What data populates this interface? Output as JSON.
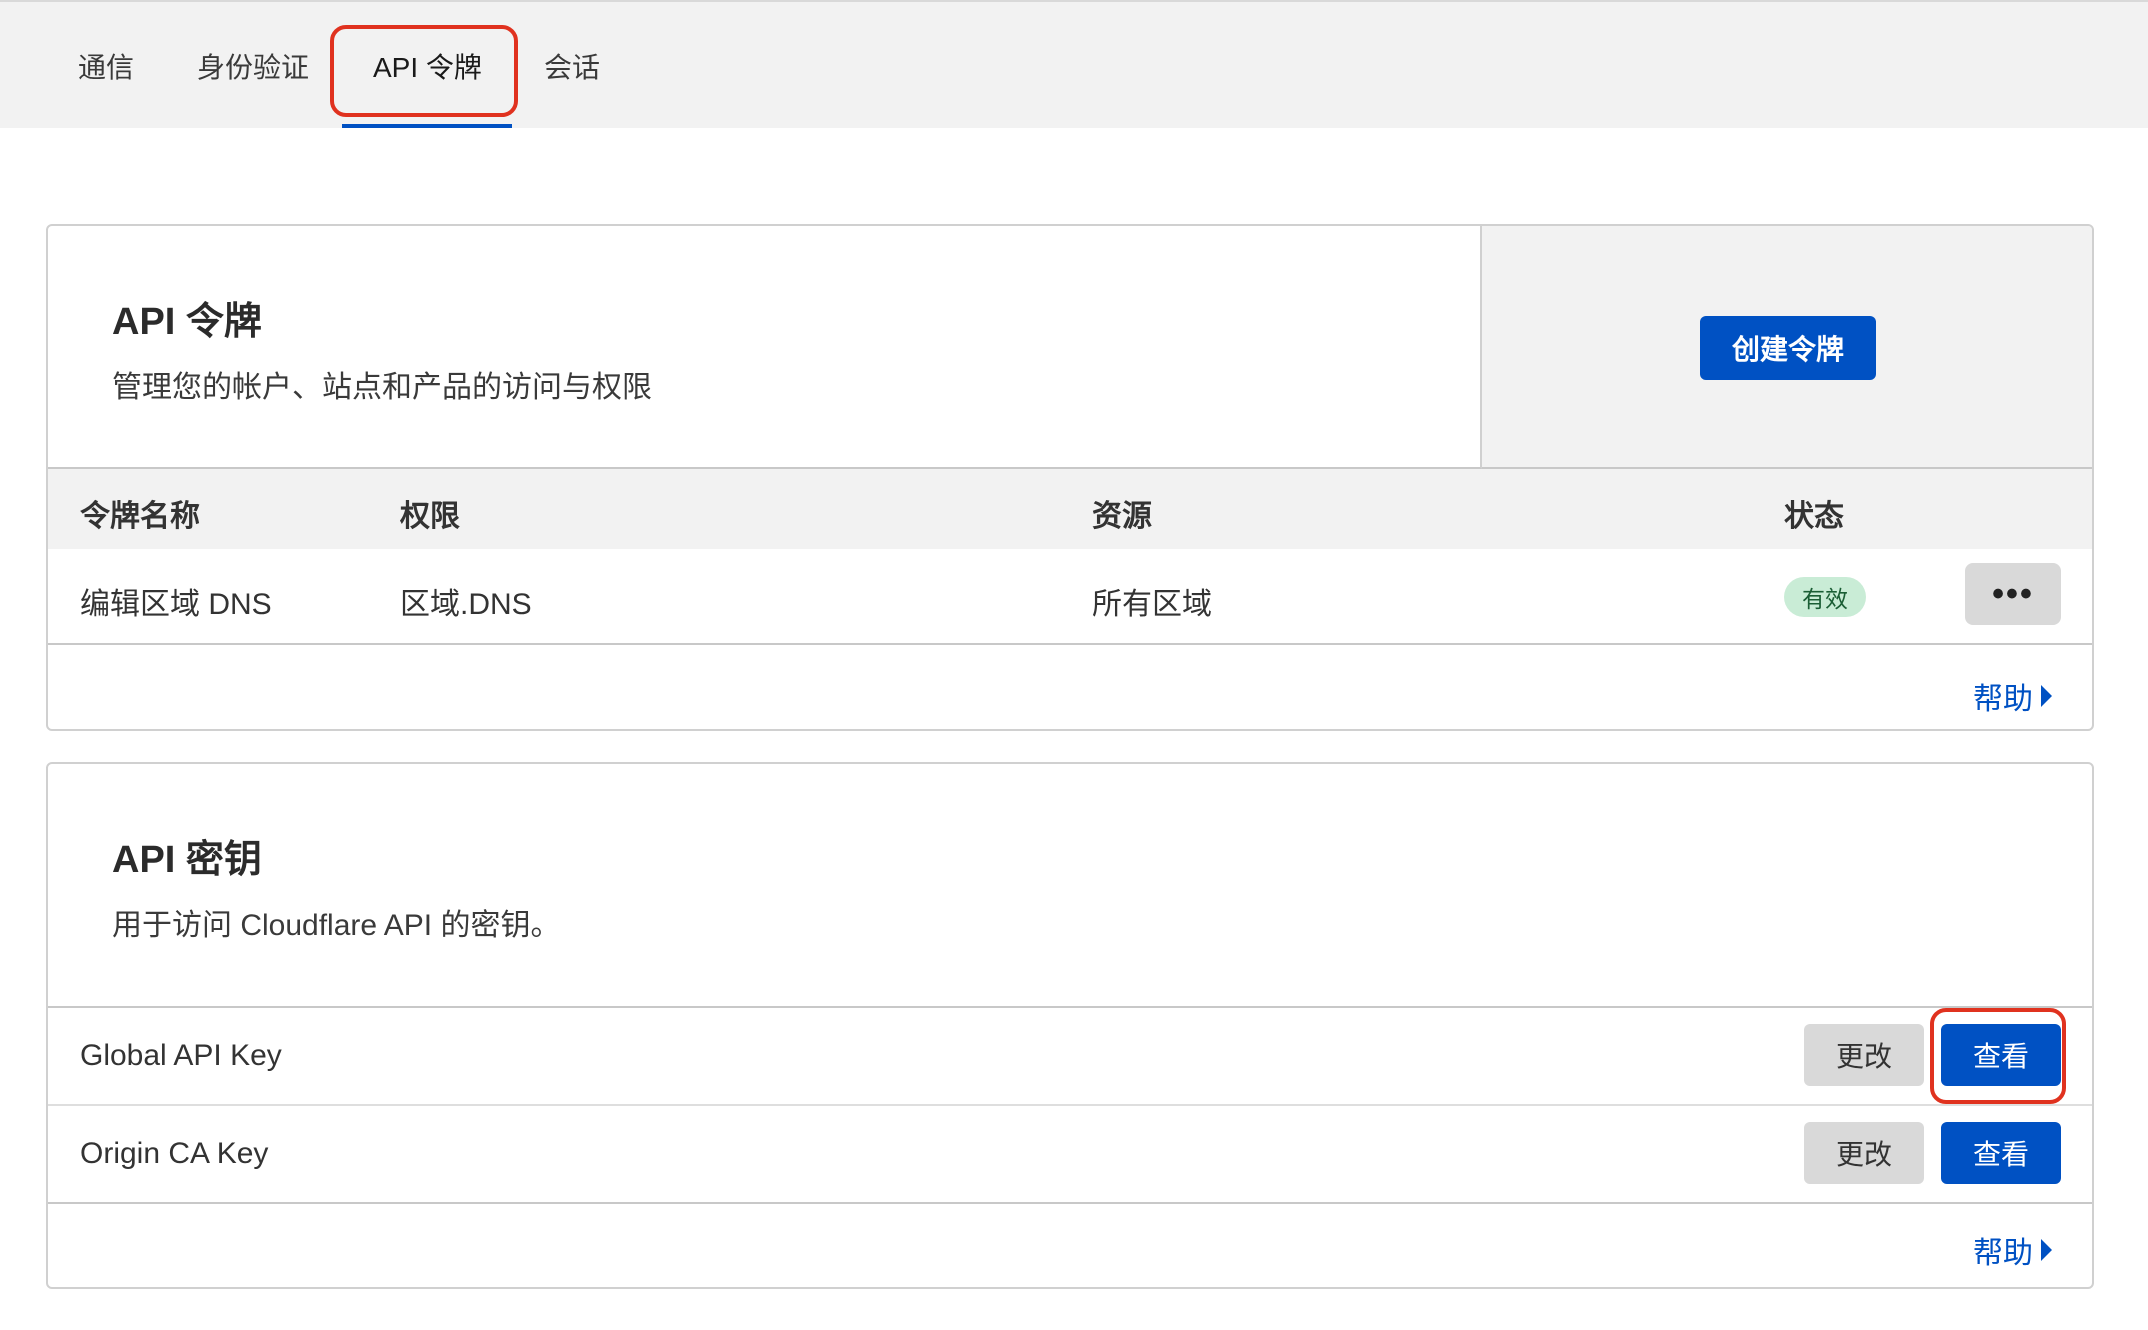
{
  "tabs": [
    {
      "label": "通信"
    },
    {
      "label": "身份验证"
    },
    {
      "label": "API 令牌",
      "active": true
    },
    {
      "label": "会话"
    }
  ],
  "tokens": {
    "title": "API 令牌",
    "description": "管理您的帐户、站点和产品的访问与权限",
    "create_label": "创建令牌",
    "columns": [
      "令牌名称",
      "权限",
      "资源",
      "状态"
    ],
    "rows": [
      {
        "name": "编辑区域 DNS",
        "permission": "区域.DNS",
        "resource": "所有区域",
        "status": "有效",
        "more": "•••"
      }
    ],
    "help_label": "帮助"
  },
  "keys": {
    "title": "API 密钥",
    "description": "用于访问 Cloudflare API 的密钥。",
    "items": [
      {
        "name": "Global API Key",
        "change_label": "更改",
        "view_label": "查看"
      },
      {
        "name": "Origin CA Key",
        "change_label": "更改",
        "view_label": "查看"
      }
    ],
    "help_label": "帮助"
  },
  "colors": {
    "primary": "#0051c3",
    "highlight": "#e0321f",
    "status_active_bg": "#c9ecd6"
  }
}
